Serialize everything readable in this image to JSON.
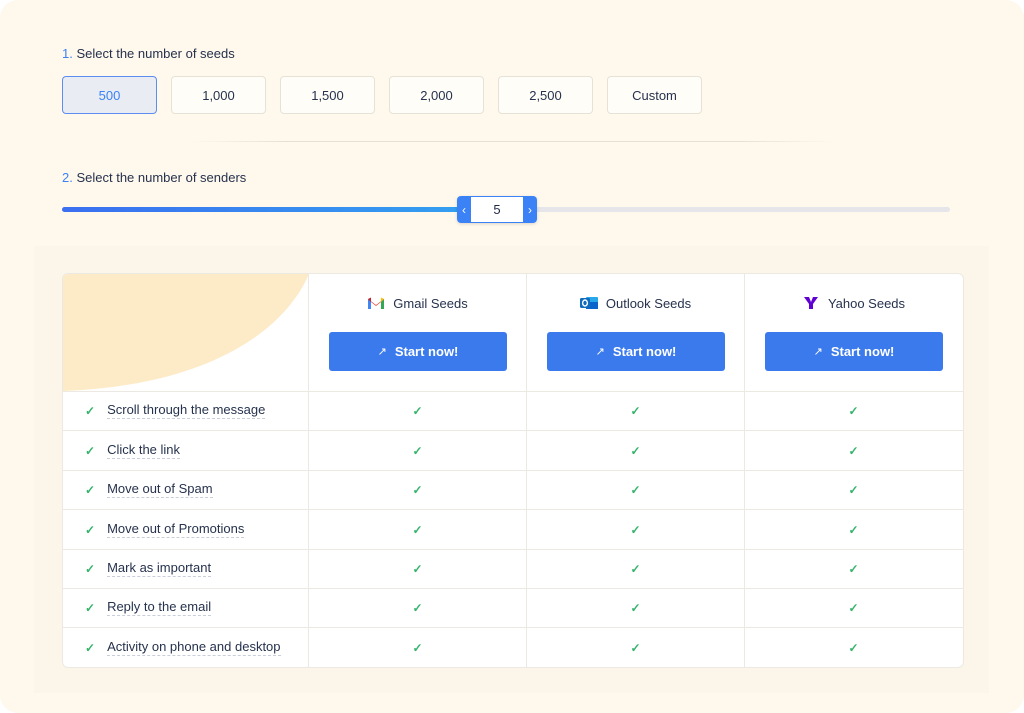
{
  "step1": {
    "number": "1.",
    "label": "Select the number of seeds"
  },
  "seed_options": [
    {
      "label": "500",
      "selected": true
    },
    {
      "label": "1,000",
      "selected": false
    },
    {
      "label": "1,500",
      "selected": false
    },
    {
      "label": "2,000",
      "selected": false
    },
    {
      "label": "2,500",
      "selected": false
    },
    {
      "label": "Custom",
      "selected": false
    }
  ],
  "step2": {
    "number": "2.",
    "label": "Select the number of senders"
  },
  "slider": {
    "value": "5",
    "fill_fraction": 0.49
  },
  "providers": [
    {
      "name": "Gmail Seeds",
      "icon": "gmail-icon",
      "button": "Start now!"
    },
    {
      "name": "Outlook Seeds",
      "icon": "outlook-icon",
      "button": "Start now!"
    },
    {
      "name": "Yahoo Seeds",
      "icon": "yahoo-icon",
      "button": "Start now!"
    }
  ],
  "features": [
    "Scroll through the message",
    "Click the link",
    "Move out of Spam",
    "Move out of Promotions",
    "Mark as important",
    "Reply to the email",
    "Activity on phone and desktop"
  ],
  "check_symbol": "✓",
  "colors": {
    "accent": "#3b7aed",
    "check": "#34b36a",
    "background": "#fff8ec"
  }
}
